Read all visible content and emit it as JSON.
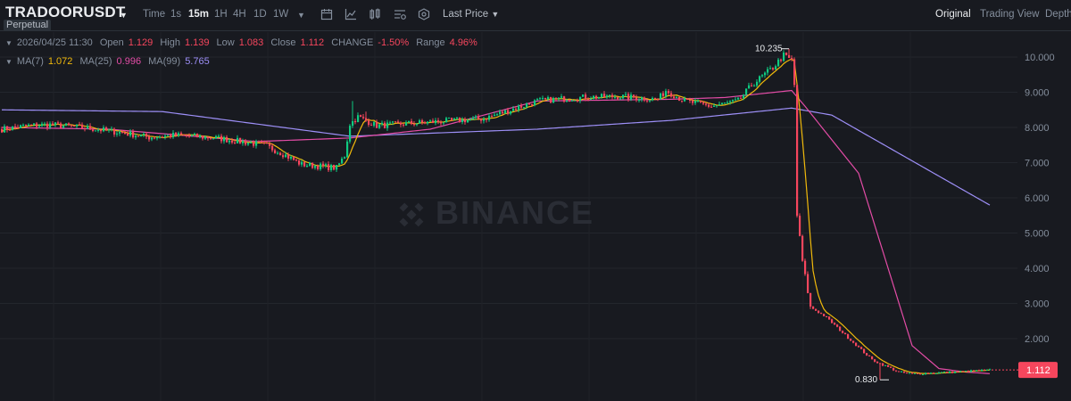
{
  "header": {
    "symbol": "TRADOORUSDT",
    "badge": "Perpetual",
    "timeframes": [
      "Time",
      "1s",
      "15m",
      "1H",
      "4H",
      "1D",
      "1W"
    ],
    "active_timeframe": "15m",
    "price_type": "Last Price",
    "views": [
      "Original",
      "Trading View",
      "Depth"
    ],
    "active_view": "Original"
  },
  "ohlc": {
    "datetime": "2026/04/25 11:30",
    "open_label": "Open",
    "open": "1.129",
    "high_label": "High",
    "high": "1.139",
    "low_label": "Low",
    "low": "1.083",
    "close_label": "Close",
    "close": "1.112",
    "change_label": "CHANGE",
    "change": "-1.50%",
    "range_label": "Range",
    "range": "4.96%"
  },
  "ma": {
    "ma7_label": "MA(7)",
    "ma7": "1.072",
    "ma25_label": "MA(25)",
    "ma25": "0.996",
    "ma99_label": "MA(99)",
    "ma99": "5.765"
  },
  "watermark": "BINANCE",
  "colors": {
    "up": "#0ecb81",
    "down": "#f6465d",
    "ma7": "#f0b90b",
    "ma25": "#e34ca6",
    "ma99": "#9d8ff7",
    "bg": "#181a20"
  },
  "chart_data": {
    "type": "candlestick",
    "y_ticks": [
      "10.000",
      "9.000",
      "8.000",
      "7.000",
      "6.000",
      "5.000",
      "4.000",
      "3.000",
      "2.000"
    ],
    "ylim": [
      0.6,
      10.6
    ],
    "grid": true,
    "high_marker": "10.235",
    "low_marker": "0.830",
    "last_price": "1.112",
    "ma99_anchors": [
      [
        0,
        8.5
      ],
      [
        60,
        8.45
      ],
      [
        130,
        7.75
      ],
      [
        200,
        7.95
      ],
      [
        250,
        8.2
      ],
      [
        295,
        8.55
      ],
      [
        310,
        8.35
      ],
      [
        370,
        5.75
      ]
    ],
    "ma25_anchors": [
      [
        0,
        8.0
      ],
      [
        40,
        7.95
      ],
      [
        95,
        7.6
      ],
      [
        130,
        7.7
      ],
      [
        160,
        7.95
      ],
      [
        200,
        8.75
      ],
      [
        250,
        8.8
      ],
      [
        270,
        8.85
      ],
      [
        295,
        9.05
      ],
      [
        300,
        8.6
      ],
      [
        320,
        6.7
      ],
      [
        340,
        1.8
      ],
      [
        350,
        1.15
      ],
      [
        360,
        1.05
      ],
      [
        370,
        1.0
      ]
    ]
  }
}
